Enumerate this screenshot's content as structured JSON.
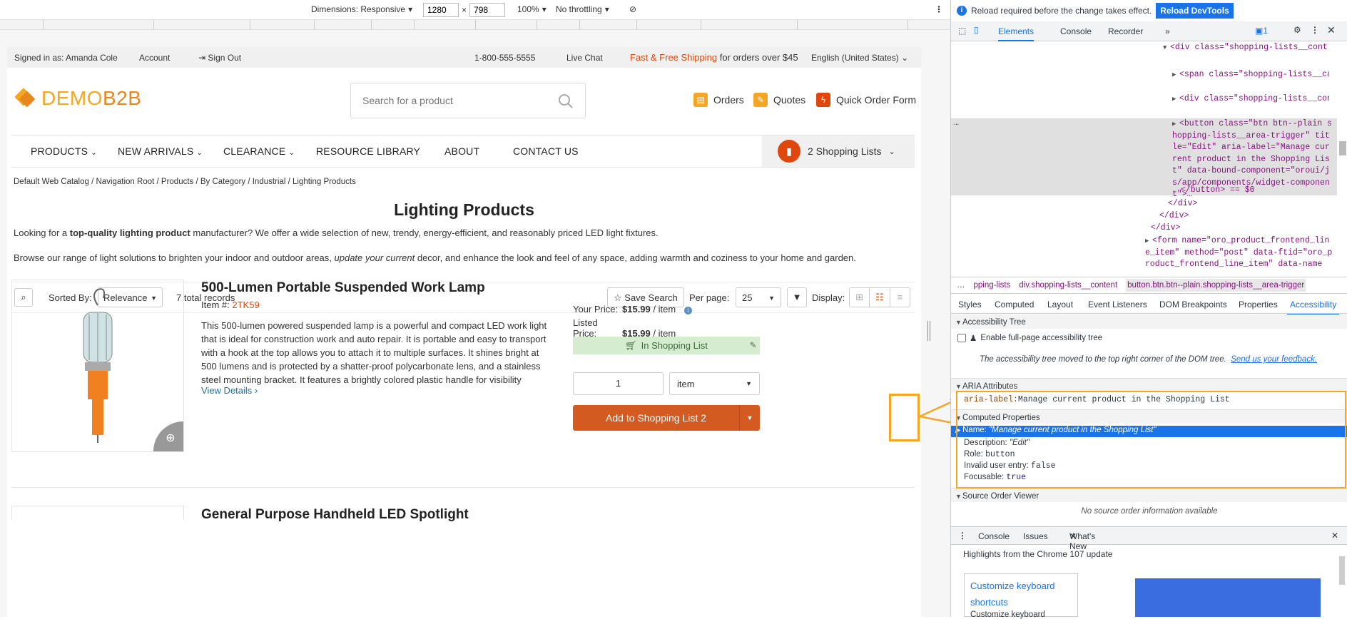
{
  "device_toolbar": {
    "dimensions_label": "Dimensions: Responsive",
    "width": "1280",
    "times": "×",
    "height": "798",
    "zoom": "100%",
    "throttling": "No throttling"
  },
  "site": {
    "topbar": {
      "signed_in": "Signed in as: Amanda Cole",
      "account": "Account",
      "sign_out": "Sign Out",
      "phone": "1-800-555-5555",
      "live_chat": "Live Chat",
      "shipping_highlight": "Fast & Free Shipping",
      "shipping_rest": "for orders over $45",
      "locale": "English (United States)"
    },
    "logo_part1": "DEMO",
    "logo_part2": "B2B",
    "search_placeholder": "Search for a product",
    "header_links": {
      "orders": "Orders",
      "quotes": "Quotes",
      "quick_order": "Quick Order Form"
    },
    "nav": [
      "PRODUCTS",
      "NEW ARRIVALS",
      "CLEARANCE",
      "RESOURCE LIBRARY",
      "ABOUT",
      "CONTACT US"
    ],
    "shopping_lists_label": "2 Shopping Lists",
    "breadcrumb": "Default Web Catalog / Navigation Root / Products / By Category / Industrial / Lighting Products",
    "page_title": "Lighting Products",
    "intro1_before": "Looking for a ",
    "intro1_bold": "top-quality lighting product",
    "intro1_after": " manufacturer? We offer a wide selection of new, trendy, energy-efficient, and reasonably priced LED light fixtures.",
    "intro2_before": "Browse our range of light solutions to brighten your indoor and outdoor areas, ",
    "intro2_italic": "update your current",
    "intro2_after": " decor, and enhance the look and feel of any space, adding warmth and coziness to your home and garden.",
    "toolbar": {
      "sorted_by": "Sorted By:",
      "sort_value": "Relevance",
      "total": "7 total records",
      "save_search": "Save Search",
      "per_page": "Per page:",
      "per_page_value": "25",
      "display": "Display:"
    },
    "product": {
      "title": "500-Lumen Portable Suspended Work Lamp",
      "item_label": "Item #:",
      "item_number": "2TK59",
      "description": "This 500-lumen powered suspended lamp is a powerful and compact LED work light that is ideal for construction work and auto repair. It is portable and easy to transport with a hook at the top allows you to attach it to multiple surfaces. It shines bright at 500 lumens and is protected by a shatter-proof polycarbonate lens, and a stainless steel mounting bracket. It features a brightly colored plastic handle for visibility",
      "view_details": "View Details",
      "your_price_label": "Your Price:",
      "your_price": "$15.99",
      "listed_price_label": "Listed Price:",
      "listed_price": "$15.99",
      "per_item": "/ item",
      "in_list": "In Shopping List",
      "quantity": "1",
      "unit": "item",
      "add_button": "Add to Shopping List 2"
    },
    "next_product_title": "General Purpose Handheld LED Spotlight"
  },
  "devtools": {
    "reload_notice": "Reload required before the change takes effect.",
    "reload_button": "Reload DevTools",
    "tabs": [
      "Elements",
      "Console",
      "Recorder"
    ],
    "issues_count": "1",
    "dom_lines": [
      "<div class=\"shopping-lists__content\"> flex",
      "<span class=\"shopping-lists__cart\" aria-hidden=\"true\">…</span>",
      "<div class=\"shopping-lists__content-wrapper\">…</div>",
      "<button class=\"btn btn--plain shopping-lists__area-trigger\" title=\"Edit\" aria-label=\"Manage current product in the Shopping List\" data-bound-component=\"oroui/js/app/components/widget-component\">…",
      "</button> == $0",
      "</div>",
      "</div>",
      "</div>",
      "<form name=\"oro_product_frontend_line_item\" method=\"post\" data-ftid=\"oro_product_frontend_line_item\" data-name=\"form_"
    ],
    "crumbs": [
      "…",
      "pping-lists",
      "div.shopping-lists__content",
      "button.btn.btn--plain.shopping-lists__area-trigger"
    ],
    "subtabs": [
      "Styles",
      "Computed",
      "Layout",
      "Event Listeners",
      "DOM Breakpoints",
      "Properties",
      "Accessibility"
    ],
    "accessibility_tree": "Accessibility Tree",
    "enable_full_page": "Enable full-page accessibility tree",
    "moved_note": "The accessibility tree moved to the top right corner of the DOM tree.",
    "feedback": "Send us your feedback.",
    "aria_attributes": "ARIA Attributes",
    "aria_key": "aria-label:",
    "aria_value": "Manage current product in the Shopping List",
    "computed_properties": "Computed Properties",
    "props": {
      "name_key": "Name:",
      "name_val": "\"Manage current product in the Shopping List\"",
      "description_key": "Description:",
      "description_val": "\"Edit\"",
      "role_key": "Role:",
      "role_val": "button",
      "invalid_key": "Invalid user entry:",
      "invalid_val": "false",
      "focusable_key": "Focusable:",
      "focusable_val": "true"
    },
    "source_order": "Source Order Viewer",
    "no_source": "No source order information available",
    "drawer_tabs": [
      "Console",
      "Issues",
      "What's New"
    ],
    "highlights": "Highlights from the Chrome 107 update",
    "card_title": "Customize keyboard shortcuts",
    "card_sub": "Customize keyboard"
  },
  "colors": {
    "accent": "#e0470c",
    "highlight": "#1a73e8",
    "callout": "#f5a623",
    "in_list_bg": "#d6ecd0"
  }
}
